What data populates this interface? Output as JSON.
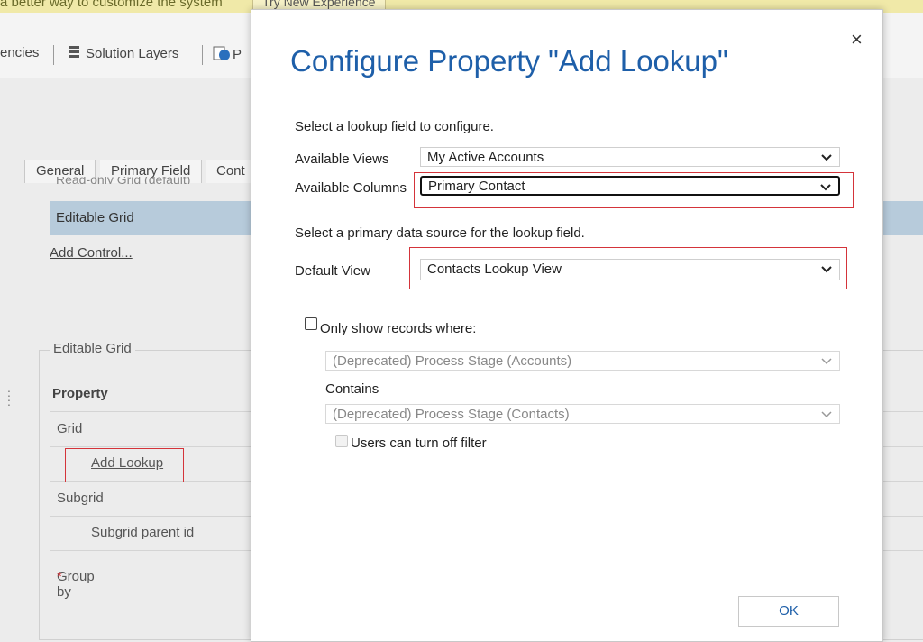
{
  "banner": {
    "text": "a better way to customize the system",
    "button": "Try New Experience"
  },
  "toolbar": {
    "items": [
      "encies",
      "Solution Layers",
      "P"
    ],
    "icons": [
      "solution-layers-icon",
      "publish-icon"
    ]
  },
  "tabs": [
    "General",
    "Primary Field",
    "Cont"
  ],
  "background": {
    "ghost_row": "Read-only Grid (default)",
    "editable_grid": "Editable Grid",
    "add_control": "Add Control...",
    "fieldset_legend": "Editable Grid",
    "property_header": "Property",
    "rows": [
      "Grid",
      "Add Lookup",
      "Subgrid",
      "Subgrid parent id",
      "Group by"
    ],
    "required_mark": "*"
  },
  "dialog": {
    "title": "Configure Property \"Add Lookup\"",
    "close": "×",
    "intro": "Select a lookup field to configure.",
    "available_views_label": "Available Views",
    "available_views_value": "My Active Accounts",
    "available_columns_label": "Available Columns",
    "available_columns_value": "Primary Contact",
    "source_intro": "Select a primary data source for the lookup field.",
    "default_view_label": "Default View",
    "default_view_value": "Contacts Lookup View",
    "only_show_label": "Only show records where:",
    "filter_source_value": "(Deprecated) Process Stage (Accounts)",
    "contains_label": "Contains",
    "filter_target_value": "(Deprecated) Process Stage (Contacts)",
    "users_can_turn_off_label": "Users can turn off filter",
    "ok": "OK"
  },
  "colors": {
    "title": "#1e5fa9",
    "highlight": "#d4343a",
    "banner": "#f0e9a8",
    "selected_row": "#b7cbdb"
  }
}
